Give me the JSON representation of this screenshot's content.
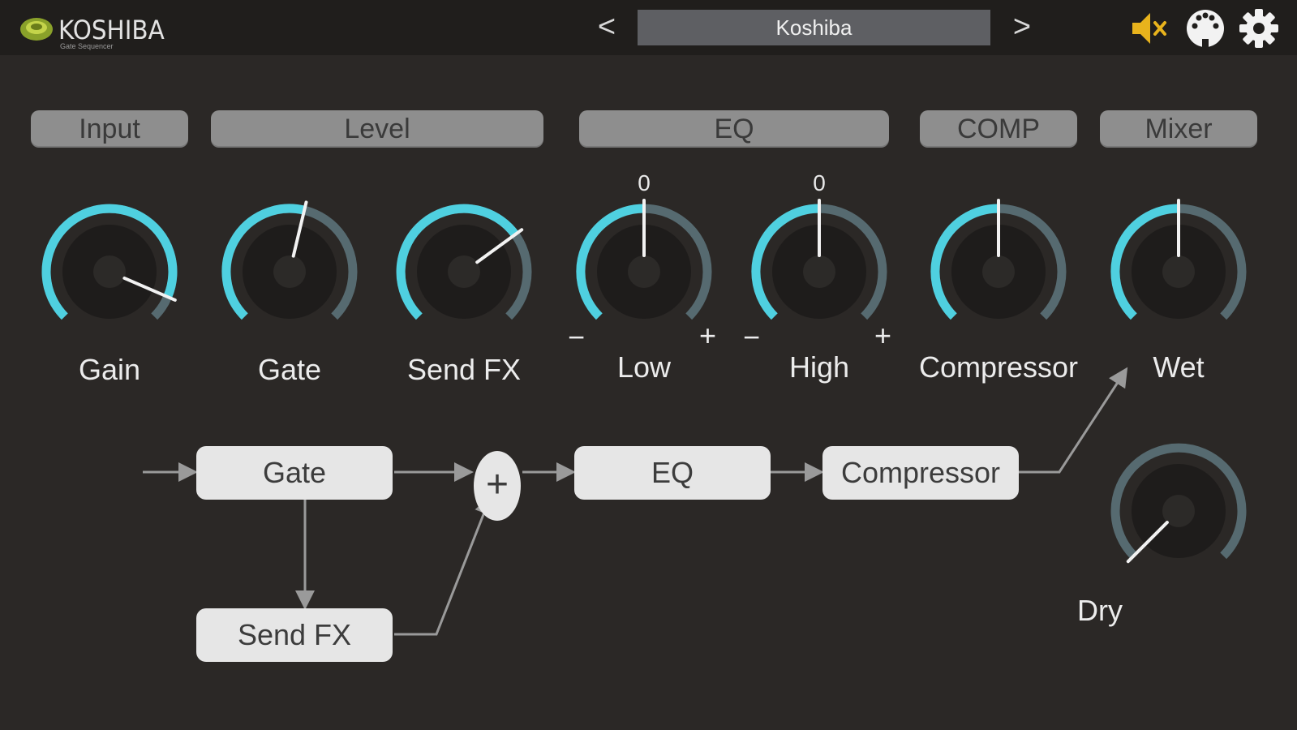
{
  "app": {
    "logo_text": "KOSHIBA",
    "logo_subtitle": "Gate Sequencer"
  },
  "header": {
    "prev_label": "<",
    "next_label": ">",
    "preset_name": "Koshiba",
    "icons": [
      "speaker-mute-icon",
      "midi-icon",
      "gear-icon"
    ],
    "accent_mute": "#e8b31c"
  },
  "sections": [
    {
      "id": "input",
      "label": "Input"
    },
    {
      "id": "level",
      "label": "Level"
    },
    {
      "id": "eq",
      "label": "EQ"
    },
    {
      "id": "comp",
      "label": "COMP"
    },
    {
      "id": "mixer",
      "label": "Mixer"
    }
  ],
  "knobs": {
    "gain": {
      "label": "Gain",
      "value": 0.92
    },
    "gate": {
      "label": "Gate",
      "value": 0.55
    },
    "send_fx": {
      "label": "Send FX",
      "value": 0.7
    },
    "low": {
      "label": "Low",
      "center_value": "0",
      "minus": "−",
      "plus": "+",
      "value": 0.5
    },
    "high": {
      "label": "High",
      "center_value": "0",
      "minus": "−",
      "plus": "+",
      "value": 0.5
    },
    "compressor": {
      "label": "Compressor",
      "value": 0.5
    },
    "wet": {
      "label": "Wet",
      "value": 0.5
    },
    "dry": {
      "label": "Dry",
      "value": 0.0
    }
  },
  "flow": {
    "gate": "Gate",
    "send_fx": "Send FX",
    "sum": "+",
    "eq": "EQ",
    "compressor": "Compressor"
  },
  "colors": {
    "accent": "#4fd0e0",
    "track": "#566a70",
    "background": "#2b2826",
    "topbar": "#201e1c",
    "section_label": "#8e8e8e",
    "flow_box": "#e6e6e6"
  }
}
